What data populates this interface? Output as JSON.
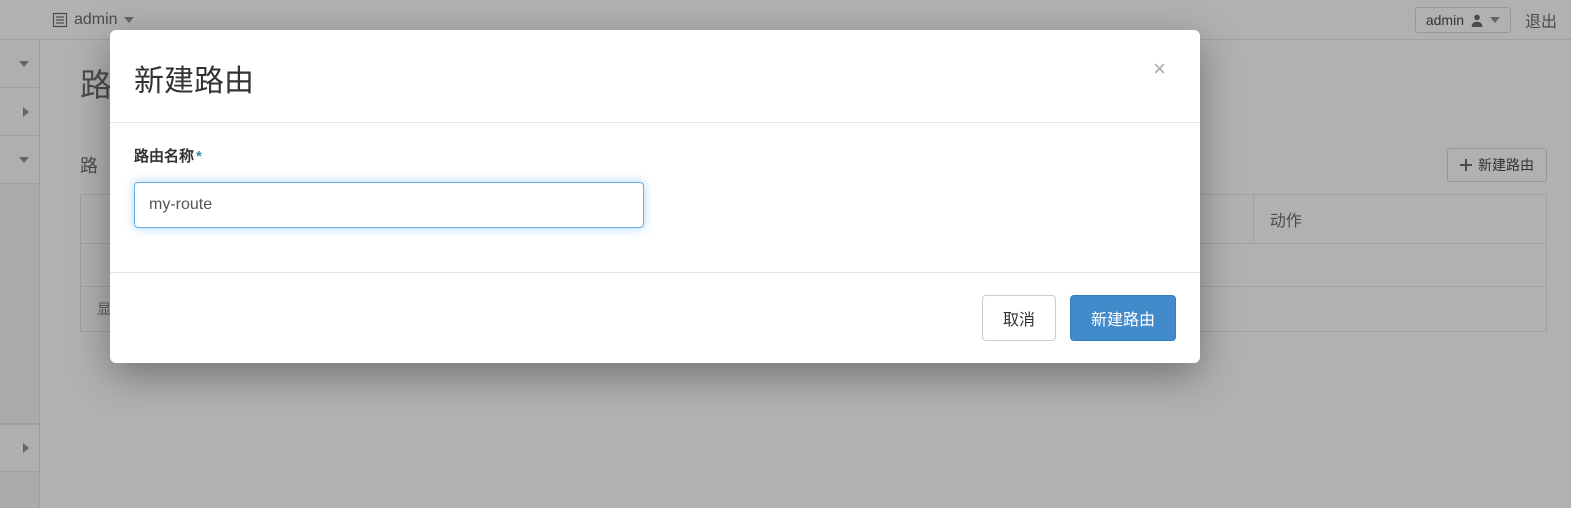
{
  "topbar": {
    "project_name": "admin",
    "user_label": "admin",
    "logout_label": "退出"
  },
  "page": {
    "title_partial": "路",
    "subhead_partial": "路",
    "new_route_btn": "新建路由",
    "table": {
      "actions_header": "动作",
      "footer_partial": "显"
    }
  },
  "modal": {
    "title": "新建路由",
    "name_label": "路由名称",
    "required_mark": "*",
    "name_value": "my-route",
    "cancel_label": "取消",
    "submit_label": "新建路由"
  }
}
